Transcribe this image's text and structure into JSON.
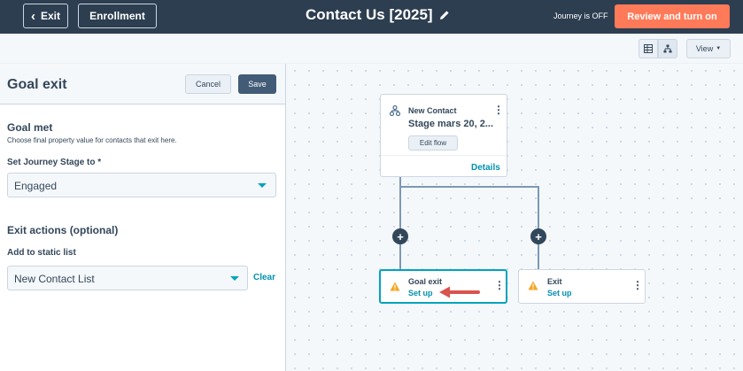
{
  "header": {
    "exit_label": "Exit",
    "enrollment_label": "Enrollment",
    "title": "Contact Us [2025]",
    "journey_status": "Journey is OFF",
    "review_label": "Review and turn on"
  },
  "toolbar": {
    "view_label": "View"
  },
  "panel": {
    "title": "Goal exit",
    "cancel_label": "Cancel",
    "save_label": "Save",
    "goal_met": {
      "title": "Goal met",
      "help": "Choose final property value for contacts that exit here."
    },
    "journey_stage": {
      "label": "Set Journey Stage to *",
      "value": "Engaged"
    },
    "exit_actions": {
      "title": "Exit actions (optional)",
      "list_label": "Add to static list",
      "list_value": "New Contact List",
      "clear_label": "Clear"
    }
  },
  "canvas": {
    "trigger_card": {
      "label": "New Contact",
      "stage": "Stage mars 20, 2...",
      "edit_label": "Edit flow",
      "details_label": "Details"
    },
    "goal_card": {
      "label": "Goal exit",
      "setup_label": "Set up"
    },
    "exit_card": {
      "label": "Exit",
      "setup_label": "Set up"
    }
  },
  "colors": {
    "topbar": "#2d3e50",
    "accent": "#ff7a59",
    "link": "#0091ae",
    "selected_border": "#00a4bd",
    "warning": "#f5a623",
    "arrow": "#d9534f"
  }
}
